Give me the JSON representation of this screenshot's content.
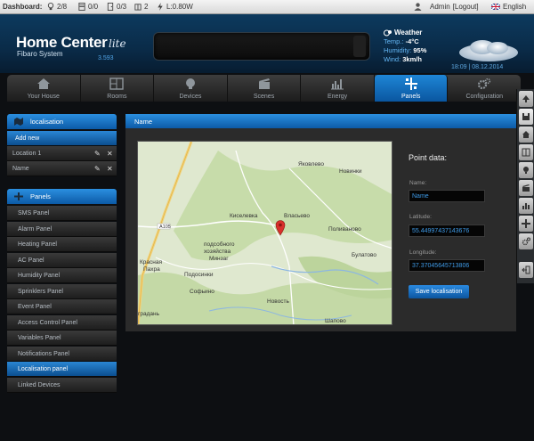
{
  "statusbar": {
    "label": "Dashboard:",
    "lights": "2/8",
    "blinds": "0/0",
    "doors": "0/3",
    "windows": "2",
    "power": "L:0.80W",
    "user": "Admin",
    "logout": "[Logout]",
    "language": "English"
  },
  "brand": {
    "title": "Home Center",
    "edition": "lite",
    "subtitle": "Fibaro System",
    "version": "3.593"
  },
  "weather": {
    "title": "Weather",
    "temp_label": "Temp.:",
    "temp": "-4°C",
    "humidity_label": "Humidity:",
    "humidity": "95%",
    "wind_label": "Wind:",
    "wind": "3km/h"
  },
  "datetime": "18:09 | 08.12.2014",
  "nav": {
    "tabs": [
      {
        "label": "Your House",
        "icon": "house-icon"
      },
      {
        "label": "Rooms",
        "icon": "rooms-icon"
      },
      {
        "label": "Devices",
        "icon": "bulb-icon"
      },
      {
        "label": "Scenes",
        "icon": "clapper-icon"
      },
      {
        "label": "Energy",
        "icon": "energy-icon"
      },
      {
        "label": "Panels",
        "icon": "panels-icon"
      },
      {
        "label": "Configuration",
        "icon": "gears-icon"
      }
    ],
    "active": "Panels"
  },
  "sidebar": {
    "localisation": {
      "header": "localisation",
      "add_new": "Add new",
      "items": [
        "Location 1",
        "Name"
      ]
    },
    "panels": {
      "header": "Panels",
      "items": [
        "SMS Panel",
        "Alarm Panel",
        "Heating Panel",
        "AC Panel",
        "Humidity Panel",
        "Sprinklers Panel",
        "Event Panel",
        "Access Control Panel",
        "Variables Panel",
        "Notifications Panel",
        "Localisation panel",
        "Linked Devices"
      ],
      "active": "Localisation panel"
    }
  },
  "main": {
    "header": "Name",
    "map_labels": {
      "yakovlevo": "Яковлево",
      "novinki": "Новинки",
      "kiselevka": "Киселевка",
      "vlasevo": "Власьево",
      "polivanovo": "Поливаново",
      "a105": "А105",
      "podsobnoe": "подсобного",
      "hozyaystva": "хозяйства",
      "minzag": "Минзаг",
      "bulatovo": "Булатово",
      "krasnaya": "Красная",
      "pakhra": "Пахра",
      "podosinki": "Подосинки",
      "sofyino": "Софьино",
      "novost": "Новость",
      "gradan": "градань",
      "shapovo": "Шапово"
    },
    "point_data": {
      "title": "Point data:",
      "name_label": "Name:",
      "name_value": "Name",
      "lat_label": "Latitude:",
      "lat_value": "55.44997437143676",
      "lng_label": "Longitude:",
      "lng_value": "37.37045645713806",
      "save": "Save localisation"
    }
  },
  "colors": {
    "accent": "#0c5aa6",
    "accent_light": "#2b8fe0",
    "marker": "#d9302c",
    "value_text": "#3f9be8"
  }
}
